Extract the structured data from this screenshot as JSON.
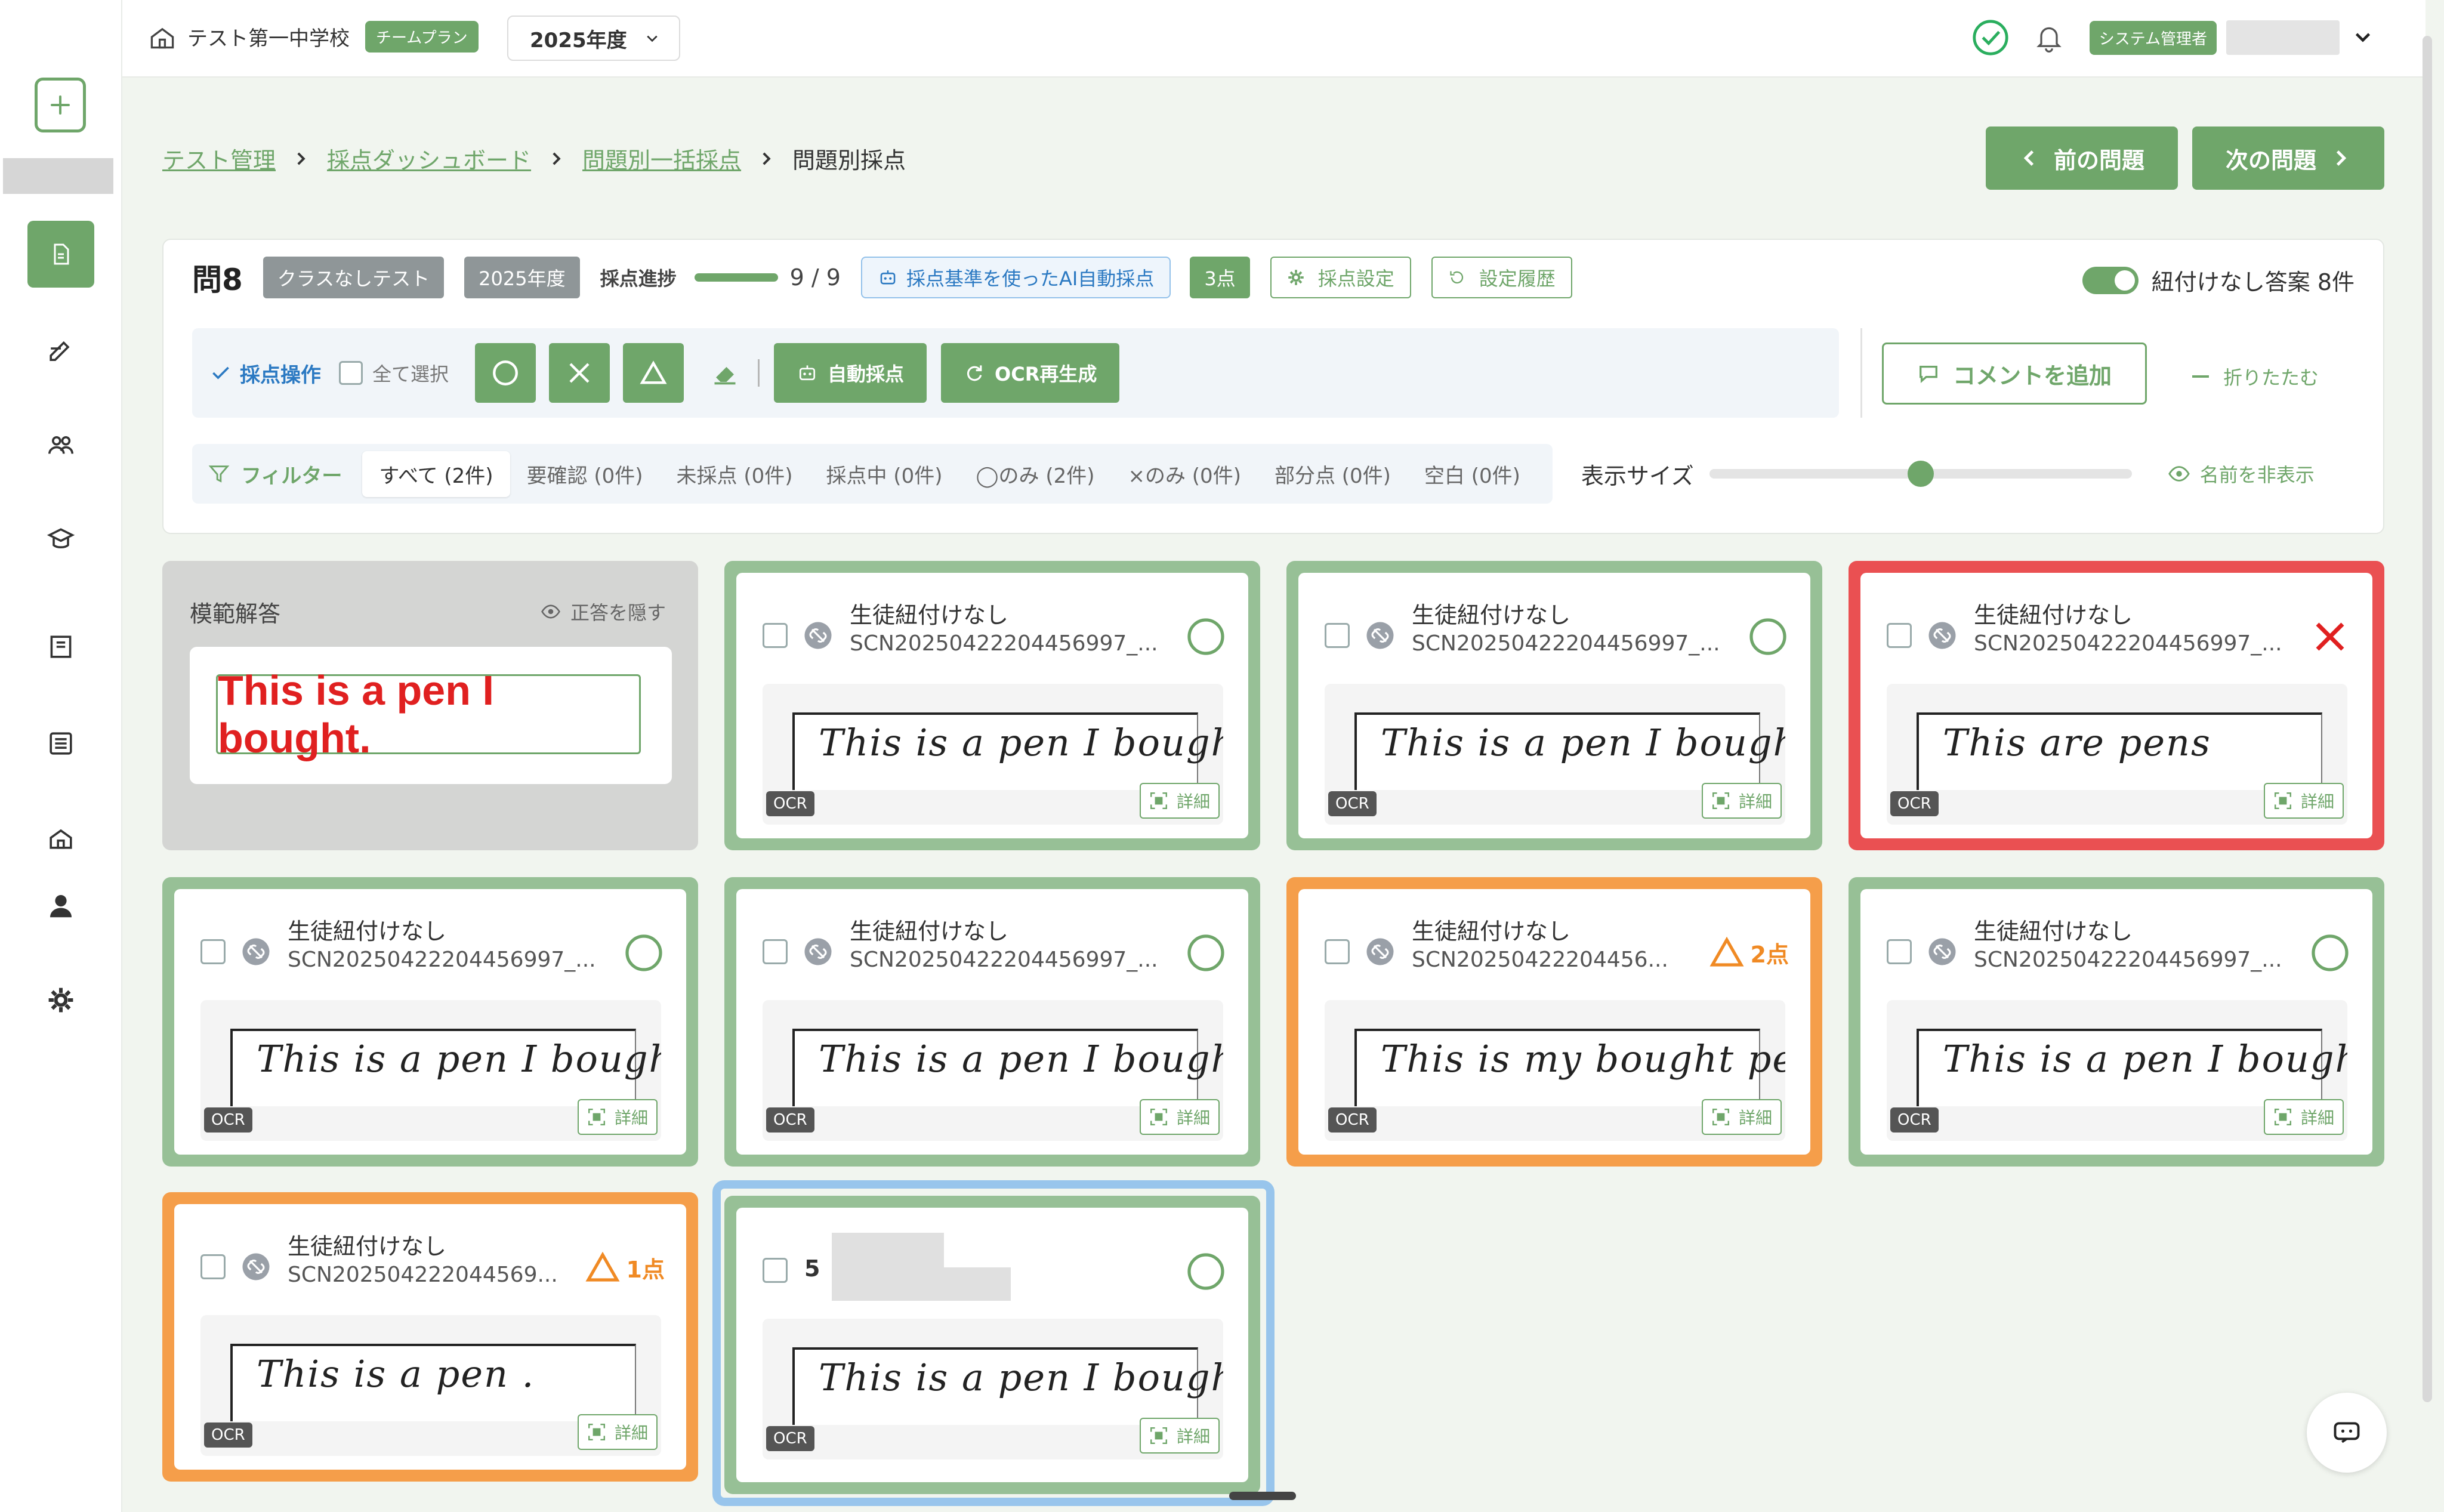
{
  "header": {
    "school_name": "テスト第一中学校",
    "plan_badge": "チームプラン",
    "year_select": "2025年度",
    "role_badge": "システム管理者"
  },
  "breadcrumb": {
    "items": [
      "テスト管理",
      "採点ダッシュボード",
      "問題別一括採点"
    ],
    "current": "問題別採点"
  },
  "nav": {
    "prev_label": "前の問題",
    "next_label": "次の問題"
  },
  "question": {
    "title": "問8",
    "class_chip": "クラスなしテスト",
    "year_chip": "2025年度",
    "progress_label": "採点進捗",
    "progress_value": "9 / 9",
    "progress_fraction": 1.0,
    "ai_chip": "採点基準を使ったAI自動採点",
    "points_chip": "3点",
    "settings_chip": "採点設定",
    "history_chip": "設定履歴",
    "toggle_label": "紐付けなし答案 8件"
  },
  "operations": {
    "label": "採点操作",
    "select_all": "全て選択",
    "auto_grade": "自動採点",
    "ocr_regen": "OCR再生成",
    "add_comment": "コメントを追加",
    "collapse": "折りたたむ"
  },
  "filters": {
    "label": "フィルター",
    "tabs": [
      "すべて (2件)",
      "要確認 (0件)",
      "未採点 (0件)",
      "採点中 (0件)",
      "◯のみ (2件)",
      "×のみ (0件)",
      "部分点 (0件)",
      "空白 (0件)"
    ],
    "active_index": 0,
    "size_label": "表示サイズ",
    "size_value": 0.5,
    "hide_names": "名前を非表示"
  },
  "model_answer": {
    "title": "模範解答",
    "hide_label": "正答を隠す",
    "text": "This is a pen I bought."
  },
  "cards": [
    {
      "name": "生徒紐付けなし",
      "scn": "SCN20250422204456997_...",
      "handwriting": "This is a pen I bought.",
      "result": "correct"
    },
    {
      "name": "生徒紐付けなし",
      "scn": "SCN20250422204456997_...",
      "handwriting": "This is a pen I bought.",
      "result": "correct"
    },
    {
      "name": "生徒紐付けなし",
      "scn": "SCN20250422204456997_...",
      "handwriting": "This are pens",
      "result": "wrong"
    },
    {
      "name": "生徒紐付けなし",
      "scn": "SCN20250422204456997_...",
      "handwriting": "This is a pen I bought.",
      "result": "correct"
    },
    {
      "name": "生徒紐付けなし",
      "scn": "SCN20250422204456997_...",
      "handwriting": "This is a pen I bought.",
      "result": "correct"
    },
    {
      "name": "生徒紐付けなし",
      "scn": "SCN20250422204456...",
      "handwriting": "This is my bought pen.",
      "result": "partial",
      "points": "2点"
    },
    {
      "name": "生徒紐付けなし",
      "scn": "SCN20250422204456997_...",
      "handwriting": "This is a pen I bought",
      "result": "correct"
    },
    {
      "name": "生徒紐付けなし",
      "scn": "SCN202504222044569...",
      "handwriting": "This is a pen .",
      "result": "partial",
      "points": "1点"
    },
    {
      "number": "5",
      "handwriting": "This is a pen I bought.",
      "result": "correct"
    }
  ],
  "card_labels": {
    "ocr": "OCR",
    "detail": "詳細"
  },
  "colors": {
    "accent": "#6fa66a",
    "wrong": "#e02020",
    "partial": "#f08a24",
    "selected": "#98c5ec"
  }
}
